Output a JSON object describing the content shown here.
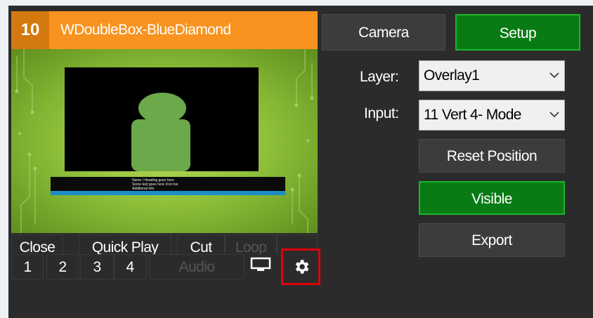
{
  "input": {
    "number": "10",
    "name": "WDoubleBox-BlueDiamond",
    "lower_third_line1": "Name / Heading goes here",
    "lower_third_line2": "Some text goes here 2nd row",
    "lower_third_line3": "Additional info"
  },
  "controls": {
    "close": "Close",
    "quick_play": "Quick Play",
    "cut": "Cut",
    "loop": "Loop",
    "n1": "1",
    "n2": "2",
    "n3": "3",
    "n4": "4",
    "audio": "Audio"
  },
  "tabs": {
    "camera": "Camera",
    "setup": "Setup",
    "active": "Setup"
  },
  "setup": {
    "layer_label": "Layer:",
    "layer_value": "Overlay1",
    "input_label": "Input:",
    "input_value": "11 Vert 4- Mode",
    "reset_position": "Reset Position",
    "visible": "Visible",
    "export": "Export"
  },
  "colors": {
    "accent_orange": "#f7931e",
    "active_green": "#087b14",
    "highlight_red": "#e0000a"
  },
  "icons": {
    "monitor": "monitor-icon",
    "settings": "gear-icon"
  }
}
